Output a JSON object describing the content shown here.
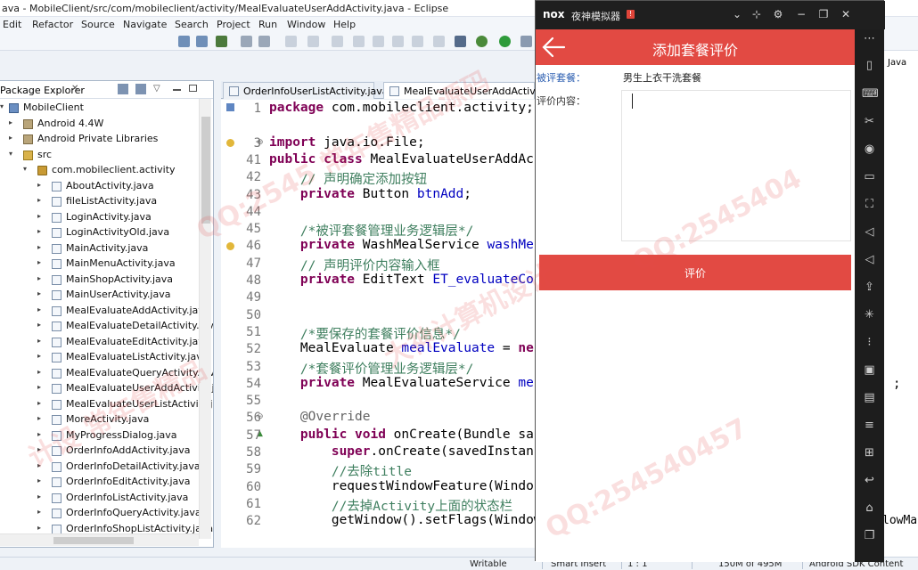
{
  "window": {
    "title": "ava - MobileClient/src/com/mobileclient/activity/MealEvaluateUserAddActivity.java - Eclipse"
  },
  "menu": [
    "Edit",
    "Refactor",
    "Source",
    "Navigate",
    "Search",
    "Project",
    "Run",
    "Window",
    "Help"
  ],
  "package_explorer": {
    "title": "Package Explorer",
    "items": [
      {
        "label": "MobileClient",
        "icon": "project-icon",
        "indent": 0,
        "toggle": "▾"
      },
      {
        "label": "Android 4.4W",
        "icon": "library-icon",
        "indent": 1,
        "toggle": "▸"
      },
      {
        "label": "Android Private Libraries",
        "icon": "library-icon",
        "indent": 1,
        "toggle": "▸"
      },
      {
        "label": "src",
        "icon": "source-folder-icon",
        "indent": 1,
        "toggle": "▾"
      },
      {
        "label": "com.mobileclient.activity",
        "icon": "package-icon",
        "indent": 2,
        "toggle": "▾"
      },
      {
        "label": "AboutActivity.java",
        "icon": "java-file-icon",
        "indent": 3,
        "toggle": "▸"
      },
      {
        "label": "fileListActivity.java",
        "icon": "java-file-icon",
        "indent": 3,
        "toggle": "▸"
      },
      {
        "label": "LoginActivity.java",
        "icon": "java-file-icon",
        "indent": 3,
        "toggle": "▸"
      },
      {
        "label": "LoginActivityOld.java",
        "icon": "java-file-icon",
        "indent": 3,
        "toggle": "▸"
      },
      {
        "label": "MainActivity.java",
        "icon": "java-file-icon",
        "indent": 3,
        "toggle": "▸"
      },
      {
        "label": "MainMenuActivity.java",
        "icon": "java-file-icon",
        "indent": 3,
        "toggle": "▸"
      },
      {
        "label": "MainShopActivity.java",
        "icon": "java-file-icon",
        "indent": 3,
        "toggle": "▸"
      },
      {
        "label": "MainUserActivity.java",
        "icon": "java-file-icon",
        "indent": 3,
        "toggle": "▸"
      },
      {
        "label": "MealEvaluateAddActivity.java",
        "icon": "java-file-icon",
        "indent": 3,
        "toggle": "▸"
      },
      {
        "label": "MealEvaluateDetailActivity.java",
        "icon": "java-file-icon",
        "indent": 3,
        "toggle": "▸"
      },
      {
        "label": "MealEvaluateEditActivity.java",
        "icon": "java-file-icon",
        "indent": 3,
        "toggle": "▸"
      },
      {
        "label": "MealEvaluateListActivity.java",
        "icon": "java-file-icon",
        "indent": 3,
        "toggle": "▸"
      },
      {
        "label": "MealEvaluateQueryActivity.java",
        "icon": "java-file-icon",
        "indent": 3,
        "toggle": "▸"
      },
      {
        "label": "MealEvaluateUserAddActivity.java",
        "icon": "java-file-icon",
        "indent": 3,
        "toggle": "▸"
      },
      {
        "label": "MealEvaluateUserListActivity.java",
        "icon": "java-file-icon",
        "indent": 3,
        "toggle": "▸"
      },
      {
        "label": "MoreActivity.java",
        "icon": "java-file-icon",
        "indent": 3,
        "toggle": "▸"
      },
      {
        "label": "MyProgressDialog.java",
        "icon": "java-file-icon",
        "indent": 3,
        "toggle": "▸"
      },
      {
        "label": "OrderInfoAddActivity.java",
        "icon": "java-file-icon",
        "indent": 3,
        "toggle": "▸"
      },
      {
        "label": "OrderInfoDetailActivity.java",
        "icon": "java-file-icon",
        "indent": 3,
        "toggle": "▸"
      },
      {
        "label": "OrderInfoEditActivity.java",
        "icon": "java-file-icon",
        "indent": 3,
        "toggle": "▸"
      },
      {
        "label": "OrderInfoListActivity.java",
        "icon": "java-file-icon",
        "indent": 3,
        "toggle": "▸"
      },
      {
        "label": "OrderInfoQueryActivity.java",
        "icon": "java-file-icon",
        "indent": 3,
        "toggle": "▸"
      },
      {
        "label": "OrderInfoShopListActivity.java",
        "icon": "java-file-icon",
        "indent": 3,
        "toggle": "▸"
      }
    ]
  },
  "editor": {
    "tabs": [
      {
        "label": "OrderInfoUserListActivity.java"
      },
      {
        "label": "MealEvaluateUserAddActivity.java"
      }
    ],
    "lines": [
      {
        "n": "1",
        "code": [
          {
            "t": "package",
            "c": "kw"
          },
          {
            "t": " com.mobileclient.activity;"
          }
        ]
      },
      {
        "n": "",
        "code": []
      },
      {
        "n": "3",
        "code": [
          {
            "t": "import",
            "c": "kw"
          },
          {
            "t": " java.io.File;"
          }
        ]
      },
      {
        "n": "41",
        "code": [
          {
            "t": "public class",
            "c": "kw"
          },
          {
            "t": " MealEvaluateUserAddAc"
          }
        ]
      },
      {
        "n": "42",
        "code": [
          {
            "t": "    // 声明确定添加按钮",
            "c": "cm"
          }
        ]
      },
      {
        "n": "43",
        "code": [
          {
            "t": "    "
          },
          {
            "t": "private",
            "c": "kw"
          },
          {
            "t": " Button "
          },
          {
            "t": "btnAdd",
            "c": "fld"
          },
          {
            "t": ";"
          }
        ]
      },
      {
        "n": "44",
        "code": []
      },
      {
        "n": "45",
        "code": [
          {
            "t": "    /*被评套餐管理业务逻辑层*/",
            "c": "cm"
          }
        ]
      },
      {
        "n": "46",
        "code": [
          {
            "t": "    "
          },
          {
            "t": "private",
            "c": "kw"
          },
          {
            "t": " WashMealService "
          },
          {
            "t": "washMe",
            "c": "fld"
          }
        ]
      },
      {
        "n": "47",
        "code": [
          {
            "t": "    // 声明评价内容输入框",
            "c": "cm"
          }
        ]
      },
      {
        "n": "48",
        "code": [
          {
            "t": "    "
          },
          {
            "t": "private",
            "c": "kw"
          },
          {
            "t": " EditText "
          },
          {
            "t": "ET_evaluateCo",
            "c": "fld"
          }
        ]
      },
      {
        "n": "49",
        "code": []
      },
      {
        "n": "50",
        "code": []
      },
      {
        "n": "51",
        "code": [
          {
            "t": "    /*要保存的套餐评价信息*/",
            "c": "cm"
          }
        ]
      },
      {
        "n": "52",
        "code": [
          {
            "t": "    MealEvaluate "
          },
          {
            "t": "mealEvaluate",
            "c": "fld"
          },
          {
            "t": " = "
          },
          {
            "t": "ne",
            "c": "kw"
          }
        ]
      },
      {
        "n": "53",
        "code": [
          {
            "t": "    /*套餐评价管理业务逻辑层*/",
            "c": "cm"
          }
        ]
      },
      {
        "n": "54",
        "code": [
          {
            "t": "    "
          },
          {
            "t": "private",
            "c": "kw"
          },
          {
            "t": " MealEvaluateService "
          },
          {
            "t": "me",
            "c": "fld"
          }
        ]
      },
      {
        "n": "55",
        "code": []
      },
      {
        "n": "56",
        "code": [
          {
            "t": "    @Override",
            "c": "ann"
          }
        ]
      },
      {
        "n": "57",
        "code": [
          {
            "t": "    "
          },
          {
            "t": "public void",
            "c": "kw"
          },
          {
            "t": " onCreate(Bundle sa"
          }
        ]
      },
      {
        "n": "58",
        "code": [
          {
            "t": "        "
          },
          {
            "t": "super",
            "c": "kw"
          },
          {
            "t": ".onCreate(savedInstan"
          }
        ]
      },
      {
        "n": "59",
        "code": [
          {
            "t": "        //去除title",
            "c": "cm"
          }
        ]
      },
      {
        "n": "60",
        "code": [
          {
            "t": "        requestWindowFeature(Windo"
          }
        ]
      },
      {
        "n": "61",
        "code": [
          {
            "t": "        //去掉Activity上面的状态栏",
            "c": "cm"
          }
        ]
      },
      {
        "n": "62",
        "code": [
          {
            "t": "        getWindow().setFlags(Window"
          }
        ]
      }
    ]
  },
  "statusbar": {
    "writable": "Writable",
    "insert": "Smart Insert",
    "position": "1 : 1",
    "memory": "150M of 495M",
    "sdk": "Android SDK Content"
  },
  "right_peek": {
    "tab": "Java",
    "semicolon": ";",
    "flow_fragment": "lowMa"
  },
  "nox": {
    "logo": "nox",
    "name": "夜神模拟器",
    "badge": "!",
    "app": {
      "title": "添加套餐评价",
      "meal_label": "被评套餐：",
      "meal_value": "男生上衣干洗套餐",
      "content_label": "评价内容：",
      "content_value": "",
      "submit_label": "评价"
    }
  },
  "colors": {
    "accent": "#e24a43",
    "keyword": "#7f0055",
    "comment": "#3f7f5f",
    "field": "#0000c0"
  }
}
